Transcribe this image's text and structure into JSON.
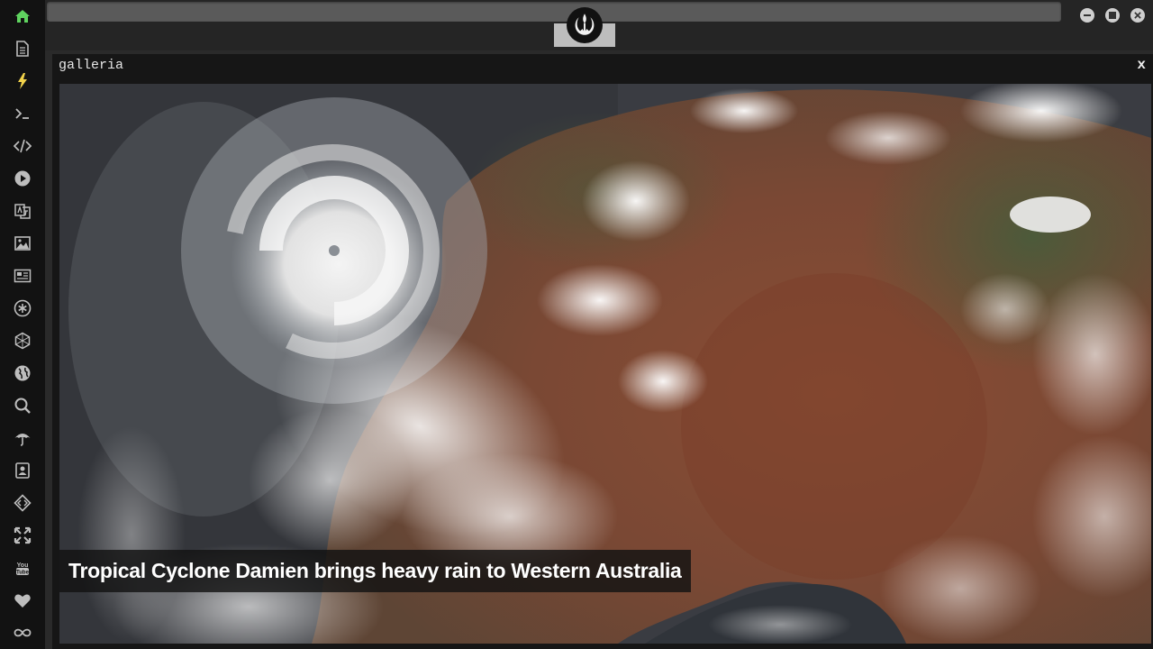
{
  "sidebar": {
    "items": [
      {
        "icon": "home-icon",
        "color": "#5fd35f"
      },
      {
        "icon": "document-icon",
        "color": "#bdbdbd"
      },
      {
        "icon": "lightning-icon",
        "color": "#f2d34b"
      },
      {
        "icon": "terminal-icon",
        "color": "#bdbdbd"
      },
      {
        "icon": "code-icon",
        "color": "#bdbdbd"
      },
      {
        "icon": "play-icon",
        "color": "#bdbdbd"
      },
      {
        "icon": "translate-icon",
        "color": "#bdbdbd"
      },
      {
        "icon": "image-icon",
        "color": "#bdbdbd"
      },
      {
        "icon": "newspaper-icon",
        "color": "#bdbdbd"
      },
      {
        "icon": "asterisk-icon",
        "color": "#bdbdbd"
      },
      {
        "icon": "hexagon-icon",
        "color": "#bdbdbd"
      },
      {
        "icon": "globe-icon",
        "color": "#bdbdbd"
      },
      {
        "icon": "search-icon",
        "color": "#bdbdbd"
      },
      {
        "icon": "umbrella-icon",
        "color": "#bdbdbd"
      },
      {
        "icon": "contact-icon",
        "color": "#bdbdbd"
      },
      {
        "icon": "diamond-code-icon",
        "color": "#bdbdbd"
      },
      {
        "icon": "expand-icon",
        "color": "#bdbdbd"
      },
      {
        "icon": "youtube-icon",
        "color": "#bdbdbd"
      },
      {
        "icon": "heart-icon",
        "color": "#bdbdbd"
      },
      {
        "icon": "infinity-icon",
        "color": "#bdbdbd"
      }
    ]
  },
  "header": {
    "logo_icon": "rebel-alliance-icon",
    "window_controls": [
      "minimize-icon",
      "maximize-icon",
      "close-icon"
    ]
  },
  "panel": {
    "title": "galleria",
    "close_label": "x"
  },
  "gallery": {
    "caption": "Tropical Cyclone Damien brings heavy rain to Western Australia"
  },
  "colors": {
    "sidebar_bg": "#121212",
    "panel_bg": "#161616",
    "accent_green": "#5fd35f",
    "accent_yellow": "#f2d34b"
  }
}
